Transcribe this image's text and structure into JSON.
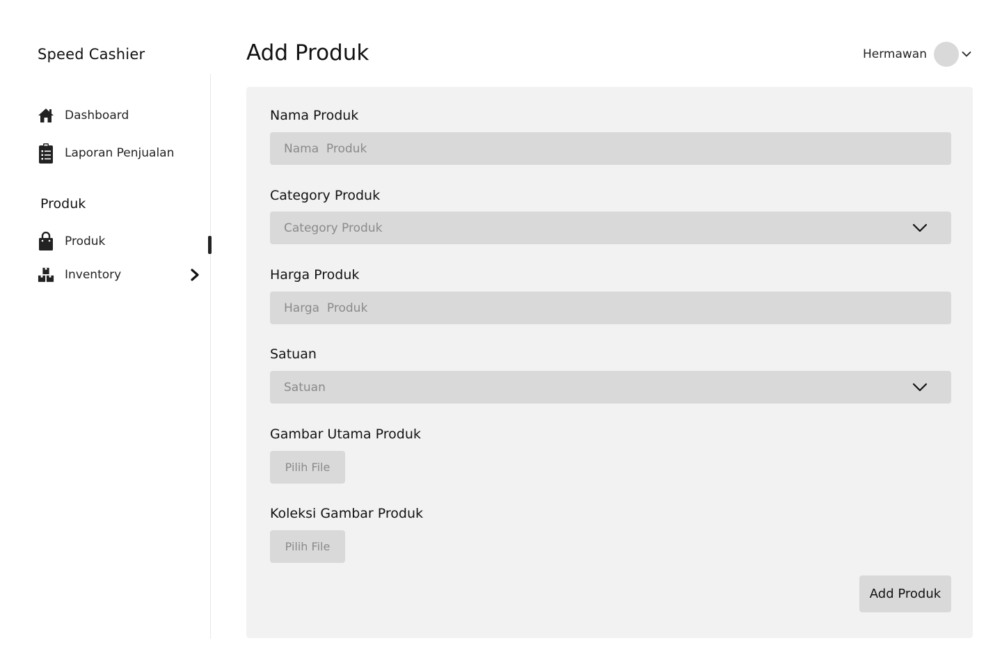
{
  "app": {
    "title": "Speed Cashier"
  },
  "sidebar": {
    "items": [
      {
        "label": "Dashboard",
        "icon": "home-icon"
      },
      {
        "label": "Laporan Penjualan",
        "icon": "clipboard-list-icon"
      }
    ],
    "section_title": "Produk",
    "produk_items": [
      {
        "label": "Produk",
        "icon": "shopping-bag-icon",
        "active": true
      },
      {
        "label": "Inventory",
        "icon": "boxes-icon",
        "expandable": true
      }
    ]
  },
  "header": {
    "page_title": "Add Produk",
    "user_name": "Hermawan"
  },
  "form": {
    "nama_produk": {
      "label": "Nama Produk",
      "placeholder": "Nama  Produk"
    },
    "category_produk": {
      "label": "Category Produk",
      "placeholder": "Category  Produk"
    },
    "harga_produk": {
      "label": "Harga Produk",
      "placeholder": "Harga  Produk"
    },
    "satuan": {
      "label": "Satuan",
      "placeholder": "Satuan"
    },
    "gambar_utama": {
      "label": "Gambar Utama Produk",
      "button": "Pilih File"
    },
    "koleksi_gambar": {
      "label": "Koleksi Gambar Produk",
      "button": "Pilih File"
    },
    "submit_label": "Add Produk"
  },
  "colors": {
    "card_bg": "#f2f2f2",
    "field_bg": "#d9d9d9",
    "placeholder_text": "#8a8a8a",
    "text": "#111111"
  }
}
